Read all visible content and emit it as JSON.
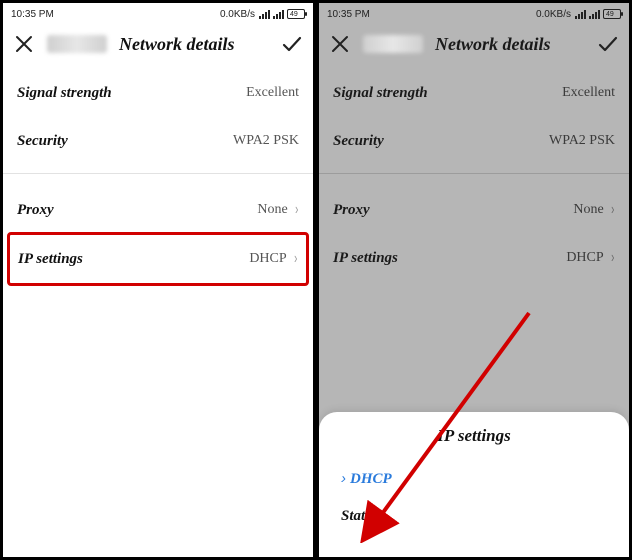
{
  "status": {
    "time": "10:35 PM",
    "net_rate": "0.0KB/s",
    "battery": "49"
  },
  "header": {
    "title": "Network details"
  },
  "rows": {
    "signal": {
      "label": "Signal strength",
      "value": "Excellent"
    },
    "security": {
      "label": "Security",
      "value": "WPA2 PSK"
    },
    "proxy": {
      "label": "Proxy",
      "value": "None"
    },
    "ip": {
      "label": "IP settings",
      "value": "DHCP"
    }
  },
  "sheet": {
    "title": "IP settings",
    "options": {
      "dhcp": "DHCP",
      "static": "Static"
    }
  }
}
